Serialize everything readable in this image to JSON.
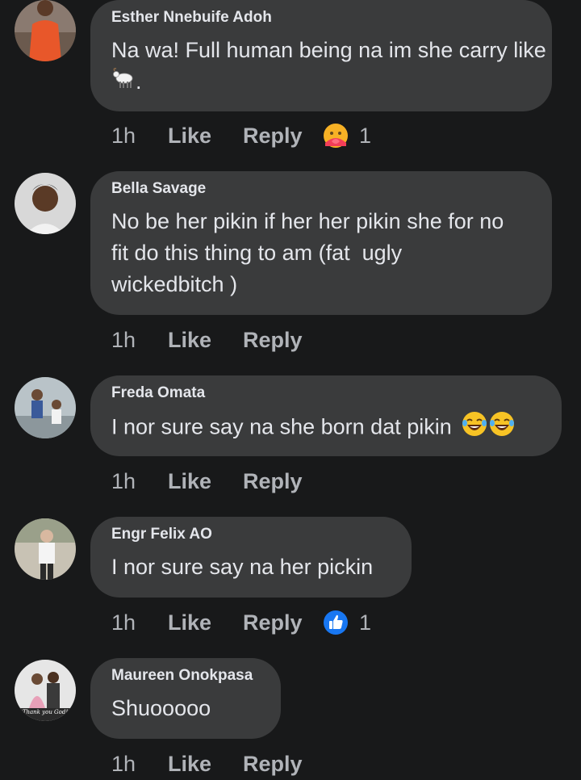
{
  "comments": [
    {
      "author": "Esther Nnebuife Adoh",
      "text": "Na wa! Full human being na im she carry like",
      "text_after_icon": ".",
      "time": "1h",
      "like_label": "Like",
      "reply_label": "Reply",
      "reaction_count": "1",
      "reaction_icon": "care-emoji-icon"
    },
    {
      "author": "Bella Savage",
      "text_line1": "No be her pikin if her her pikin she for no",
      "text_line2": "fit do this thing to am (fat  ugly",
      "text_line3": "wickedbitch )",
      "time": "1h",
      "like_label": "Like",
      "reply_label": "Reply"
    },
    {
      "author": "Freda Omata",
      "text": "I nor sure say na she born dat pikin",
      "time": "1h",
      "like_label": "Like",
      "reply_label": "Reply"
    },
    {
      "author": "Engr Felix AO",
      "text": "I nor sure say na her pickin",
      "time": "1h",
      "like_label": "Like",
      "reply_label": "Reply",
      "reaction_count": "1",
      "reaction_icon": "like-thumb-icon"
    },
    {
      "author": "Maureen Onokpasa",
      "text": "Shuooooo",
      "avatar_caption": "Thank you God!",
      "time": "1h",
      "like_label": "Like",
      "reply_label": "Reply"
    }
  ],
  "colors": {
    "background": "#18191a",
    "bubble": "#3a3b3c",
    "text_primary": "#e4e6eb",
    "text_secondary": "#b0b3b8",
    "like_blue": "#1877f2"
  }
}
